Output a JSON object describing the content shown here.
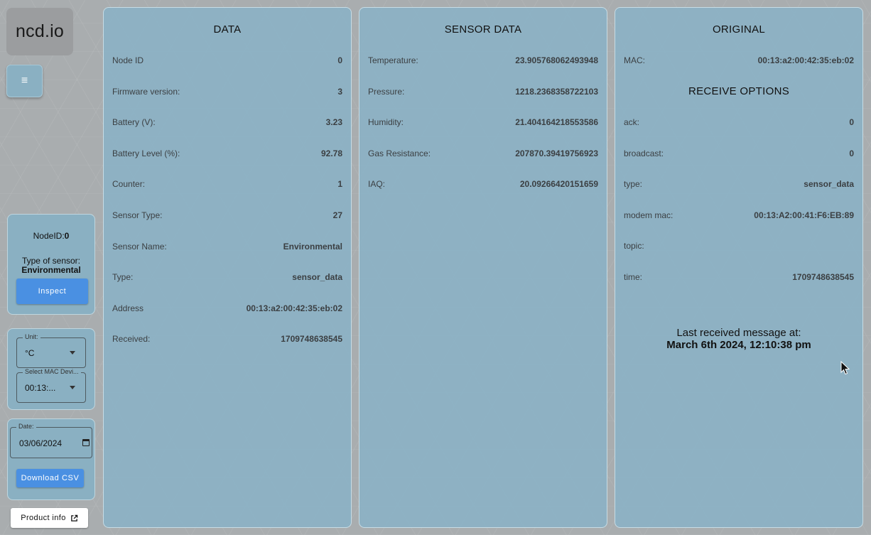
{
  "brand": {
    "logo": "ncd.io"
  },
  "menu": {
    "icon": "menu-icon",
    "glyph": "≡"
  },
  "node_card": {
    "nodeid_label": "NodeID:",
    "nodeid_value": "0",
    "type_label": "Type of sensor:",
    "type_value": "Environmental",
    "inspect_label": "Inspect"
  },
  "select_card": {
    "unit_label": "Unit:",
    "unit_value": "°C",
    "mac_label": "Select MAC Devi...",
    "mac_value": "00:13:..."
  },
  "date_card": {
    "date_label": "Date:",
    "date_value": "03/06/2024",
    "download_label": "Download CSV"
  },
  "product_info": {
    "label": "Product info",
    "icon": "external-link-icon"
  },
  "data_panel": {
    "title": "DATA",
    "rows": [
      {
        "key": "Node ID",
        "value": "0"
      },
      {
        "key": "Firmware version:",
        "value": "3"
      },
      {
        "key": "Battery (V):",
        "value": "3.23"
      },
      {
        "key": "Battery Level (%):",
        "value": "92.78"
      },
      {
        "key": "Counter:",
        "value": "1"
      },
      {
        "key": "Sensor Type:",
        "value": "27"
      },
      {
        "key": "Sensor Name:",
        "value": "Environmental"
      },
      {
        "key": "Type:",
        "value": "sensor_data"
      },
      {
        "key": "Address",
        "value": "00:13:a2:00:42:35:eb:02"
      },
      {
        "key": "Received:",
        "value": "1709748638545"
      }
    ]
  },
  "sensor_panel": {
    "title": "SENSOR DATA",
    "rows": [
      {
        "key": "Temperature:",
        "value": "23.905768062493948"
      },
      {
        "key": "Pressure:",
        "value": "1218.2368358722103"
      },
      {
        "key": "Humidity:",
        "value": "21.404164218553586"
      },
      {
        "key": "Gas Resistance:",
        "value": "207870.39419756923"
      },
      {
        "key": "IAQ:",
        "value": "20.09266420151659"
      }
    ]
  },
  "original_panel": {
    "title": "ORIGINAL",
    "mac_key": "MAC:",
    "mac_value": "00:13:a2:00:42:35:eb:02",
    "receive_title": "RECEIVE OPTIONS",
    "rows": [
      {
        "key": "ack:",
        "value": "0"
      },
      {
        "key": "broadcast:",
        "value": "0"
      },
      {
        "key": "type:",
        "value": "sensor_data"
      },
      {
        "key": "modem mac:",
        "value": "00:13:A2:00:41:F6:EB:89"
      },
      {
        "key": "topic:",
        "value": ""
      },
      {
        "key": "time:",
        "value": "1709748638545"
      }
    ],
    "last_label": "Last received message at:",
    "last_value": "March 6th 2024, 12:10:38 pm"
  }
}
